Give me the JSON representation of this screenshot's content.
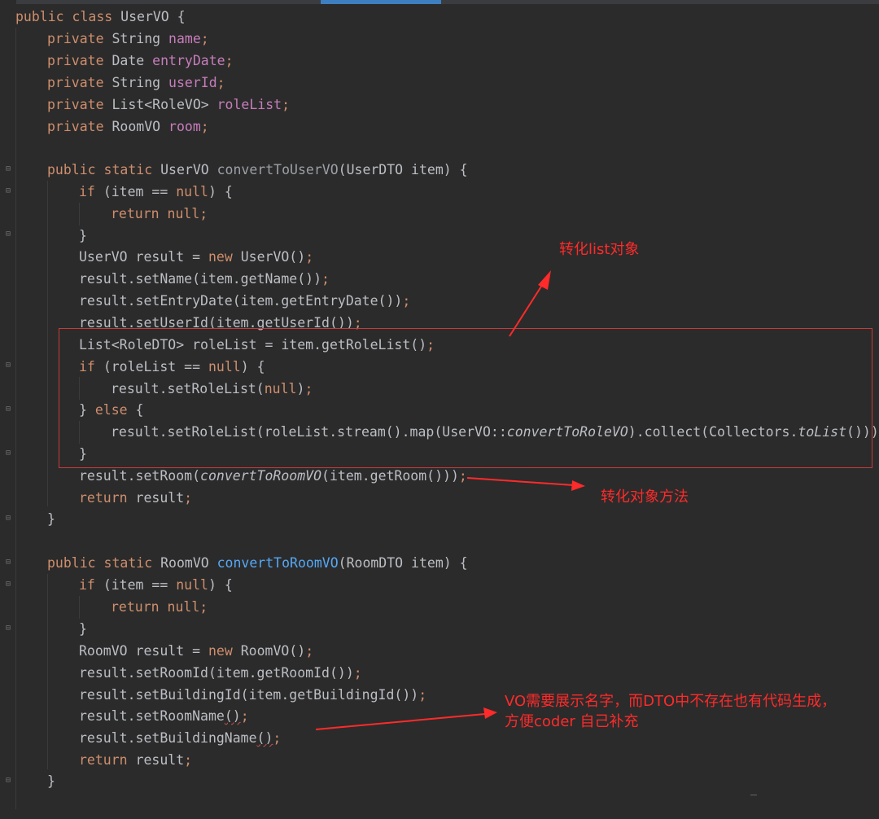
{
  "code": {
    "l1": [
      "public class ",
      "UserVO {"
    ],
    "l2": [
      "private ",
      "String ",
      "name",
      ";"
    ],
    "l3": [
      "private ",
      "Date ",
      "entryDate",
      ";"
    ],
    "l4": [
      "private ",
      "String ",
      "userId",
      ";"
    ],
    "l5": [
      "private ",
      "List<RoleVO> ",
      "roleList",
      ";"
    ],
    "l6": [
      "private ",
      "RoomVO ",
      "room",
      ";"
    ],
    "l8": [
      "public static ",
      "UserVO ",
      "convertToUserVO",
      "(UserDTO item) {"
    ],
    "l9": [
      "if ",
      "(item == ",
      "null",
      ") {"
    ],
    "l10": [
      "return null",
      ";"
    ],
    "l11": [
      "}"
    ],
    "l12": [
      "UserVO result = ",
      "new ",
      "UserVO()",
      ";"
    ],
    "l13": [
      "result.setName(item.getName())",
      ";"
    ],
    "l14": [
      "result.setEntryDate(item.getEntryDate())",
      ";"
    ],
    "l15": [
      "result.setUserId(item.getUserId())",
      ";"
    ],
    "l16": [
      "List<RoleDTO> roleList = item.getRoleList()",
      ";"
    ],
    "l17": [
      "if ",
      "(roleList == ",
      "null",
      ") {"
    ],
    "l18": [
      "result.setRoleList(",
      "null",
      ")",
      ";"
    ],
    "l19": [
      "} ",
      "else ",
      "{"
    ],
    "l20": [
      "result.setRoleList(roleList.stream().map(UserVO::",
      "convertToRoleVO",
      ").collect(Collectors.",
      "toList",
      "()))",
      ";"
    ],
    "l21": [
      "}"
    ],
    "l22": [
      "result.setRoom(",
      "convertToRoomVO",
      "(item.getRoom()))",
      ";"
    ],
    "l23": [
      "return ",
      "result",
      ";"
    ],
    "l24": [
      "}"
    ],
    "l26": [
      "public static ",
      "RoomVO ",
      "convertToRoomVO",
      "(RoomDTO item) {"
    ],
    "l27": [
      "if ",
      "(item == ",
      "null",
      ") {"
    ],
    "l28": [
      "return null",
      ";"
    ],
    "l29": [
      "}"
    ],
    "l30": [
      "RoomVO result = ",
      "new ",
      "RoomVO()",
      ";"
    ],
    "l31": [
      "result.setRoomId(item.getRoomId())",
      ";"
    ],
    "l32": [
      "result.setBuildingId(item.getBuildingId())",
      ";"
    ],
    "l33": [
      "result.setRoomName",
      "()",
      ";"
    ],
    "l34": [
      "result.setBuildingName",
      "()",
      ";"
    ],
    "l35": [
      "return ",
      "result",
      ";"
    ],
    "l36": [
      "}"
    ]
  },
  "annotations": {
    "list_convert": "转化list对象",
    "convert_method": "转化对象方法",
    "vo_note_line1": "VO需要展示名字，而DTO中不存在也有代码生成，",
    "vo_note_line2": "方便coder 自己补充"
  },
  "colors": {
    "background": "#2b2b2b",
    "keyword": "#cf8e6d",
    "field": "#c77dbb",
    "declared_method": "#56a8f5",
    "annotation_red": "#ff2a2a",
    "tab_indicator": "#3d7fc1"
  },
  "icons": {
    "fold_open": "fold-open-icon",
    "fold_close": "fold-close-icon"
  }
}
